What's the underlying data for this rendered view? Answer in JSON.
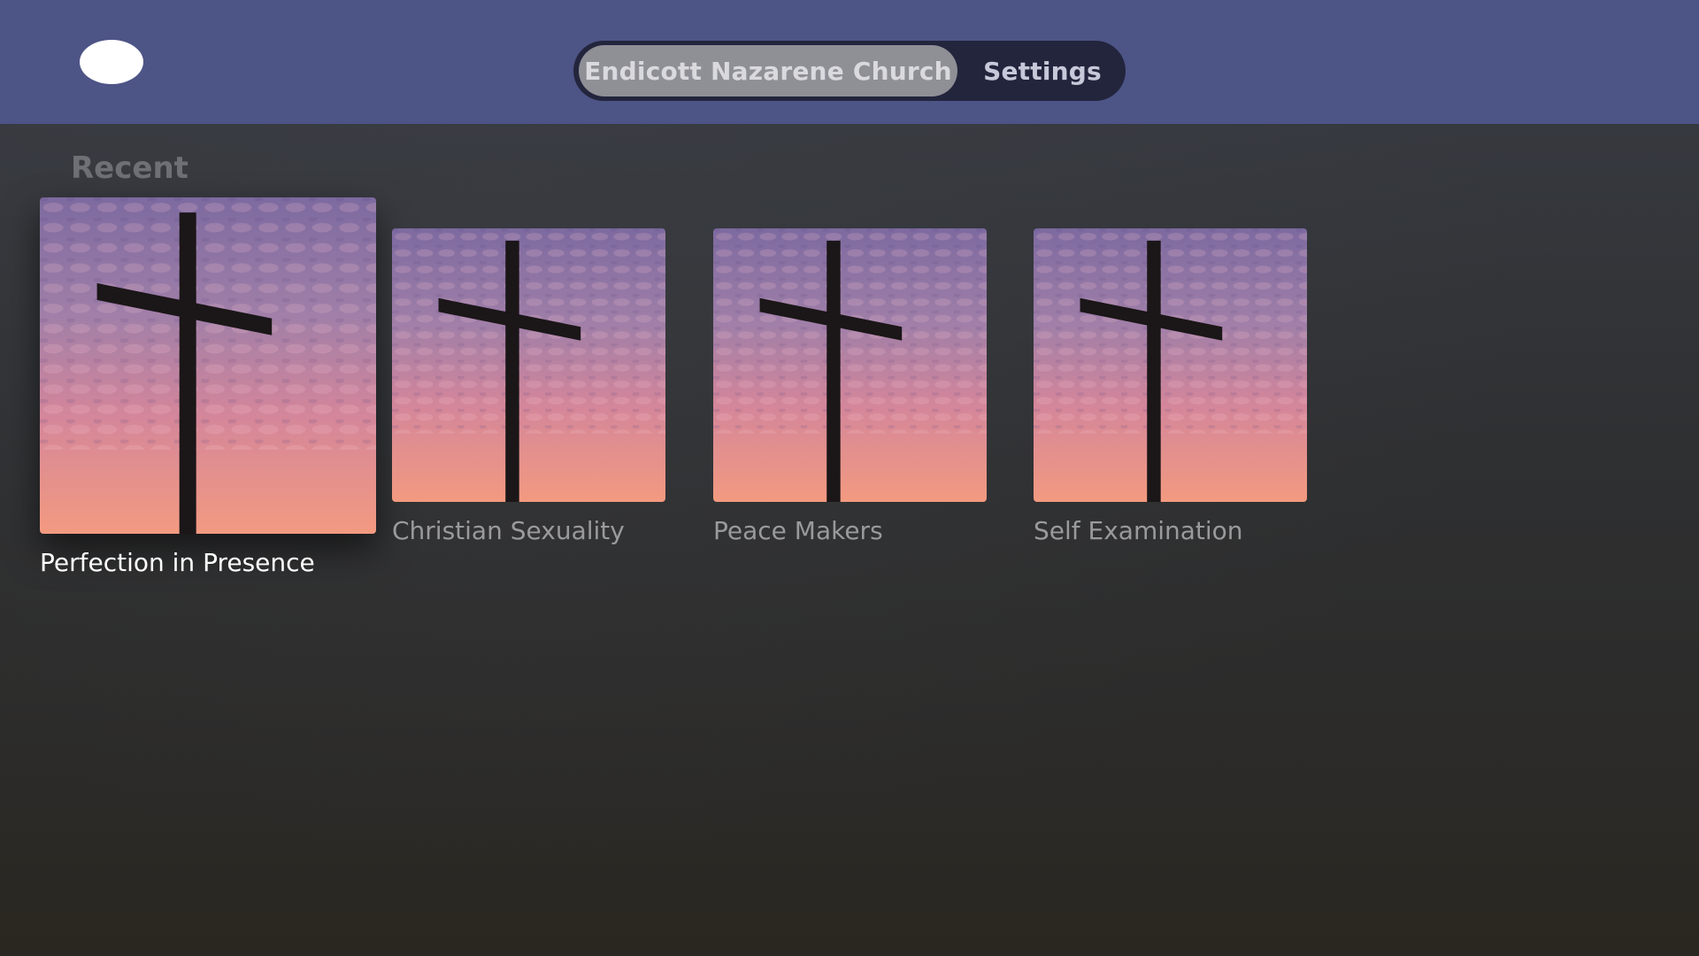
{
  "header": {
    "logo_icon": "oval-logo-icon",
    "tabs": [
      {
        "label": "Endicott Nazarene Church",
        "selected": true
      },
      {
        "label": "Settings",
        "selected": false
      }
    ],
    "background_color": "#4d5486"
  },
  "main": {
    "section_title": "Recent",
    "items": [
      {
        "title": "Perfection in Presence",
        "focused": true,
        "thumbnail_icon": "cross-sunset-image"
      },
      {
        "title": "Christian Sexuality",
        "focused": false,
        "thumbnail_icon": "cross-sunset-image"
      },
      {
        "title": "Peace Makers",
        "focused": false,
        "thumbnail_icon": "cross-sunset-image"
      },
      {
        "title": "Self Examination",
        "focused": false,
        "thumbnail_icon": "cross-sunset-image"
      }
    ]
  }
}
